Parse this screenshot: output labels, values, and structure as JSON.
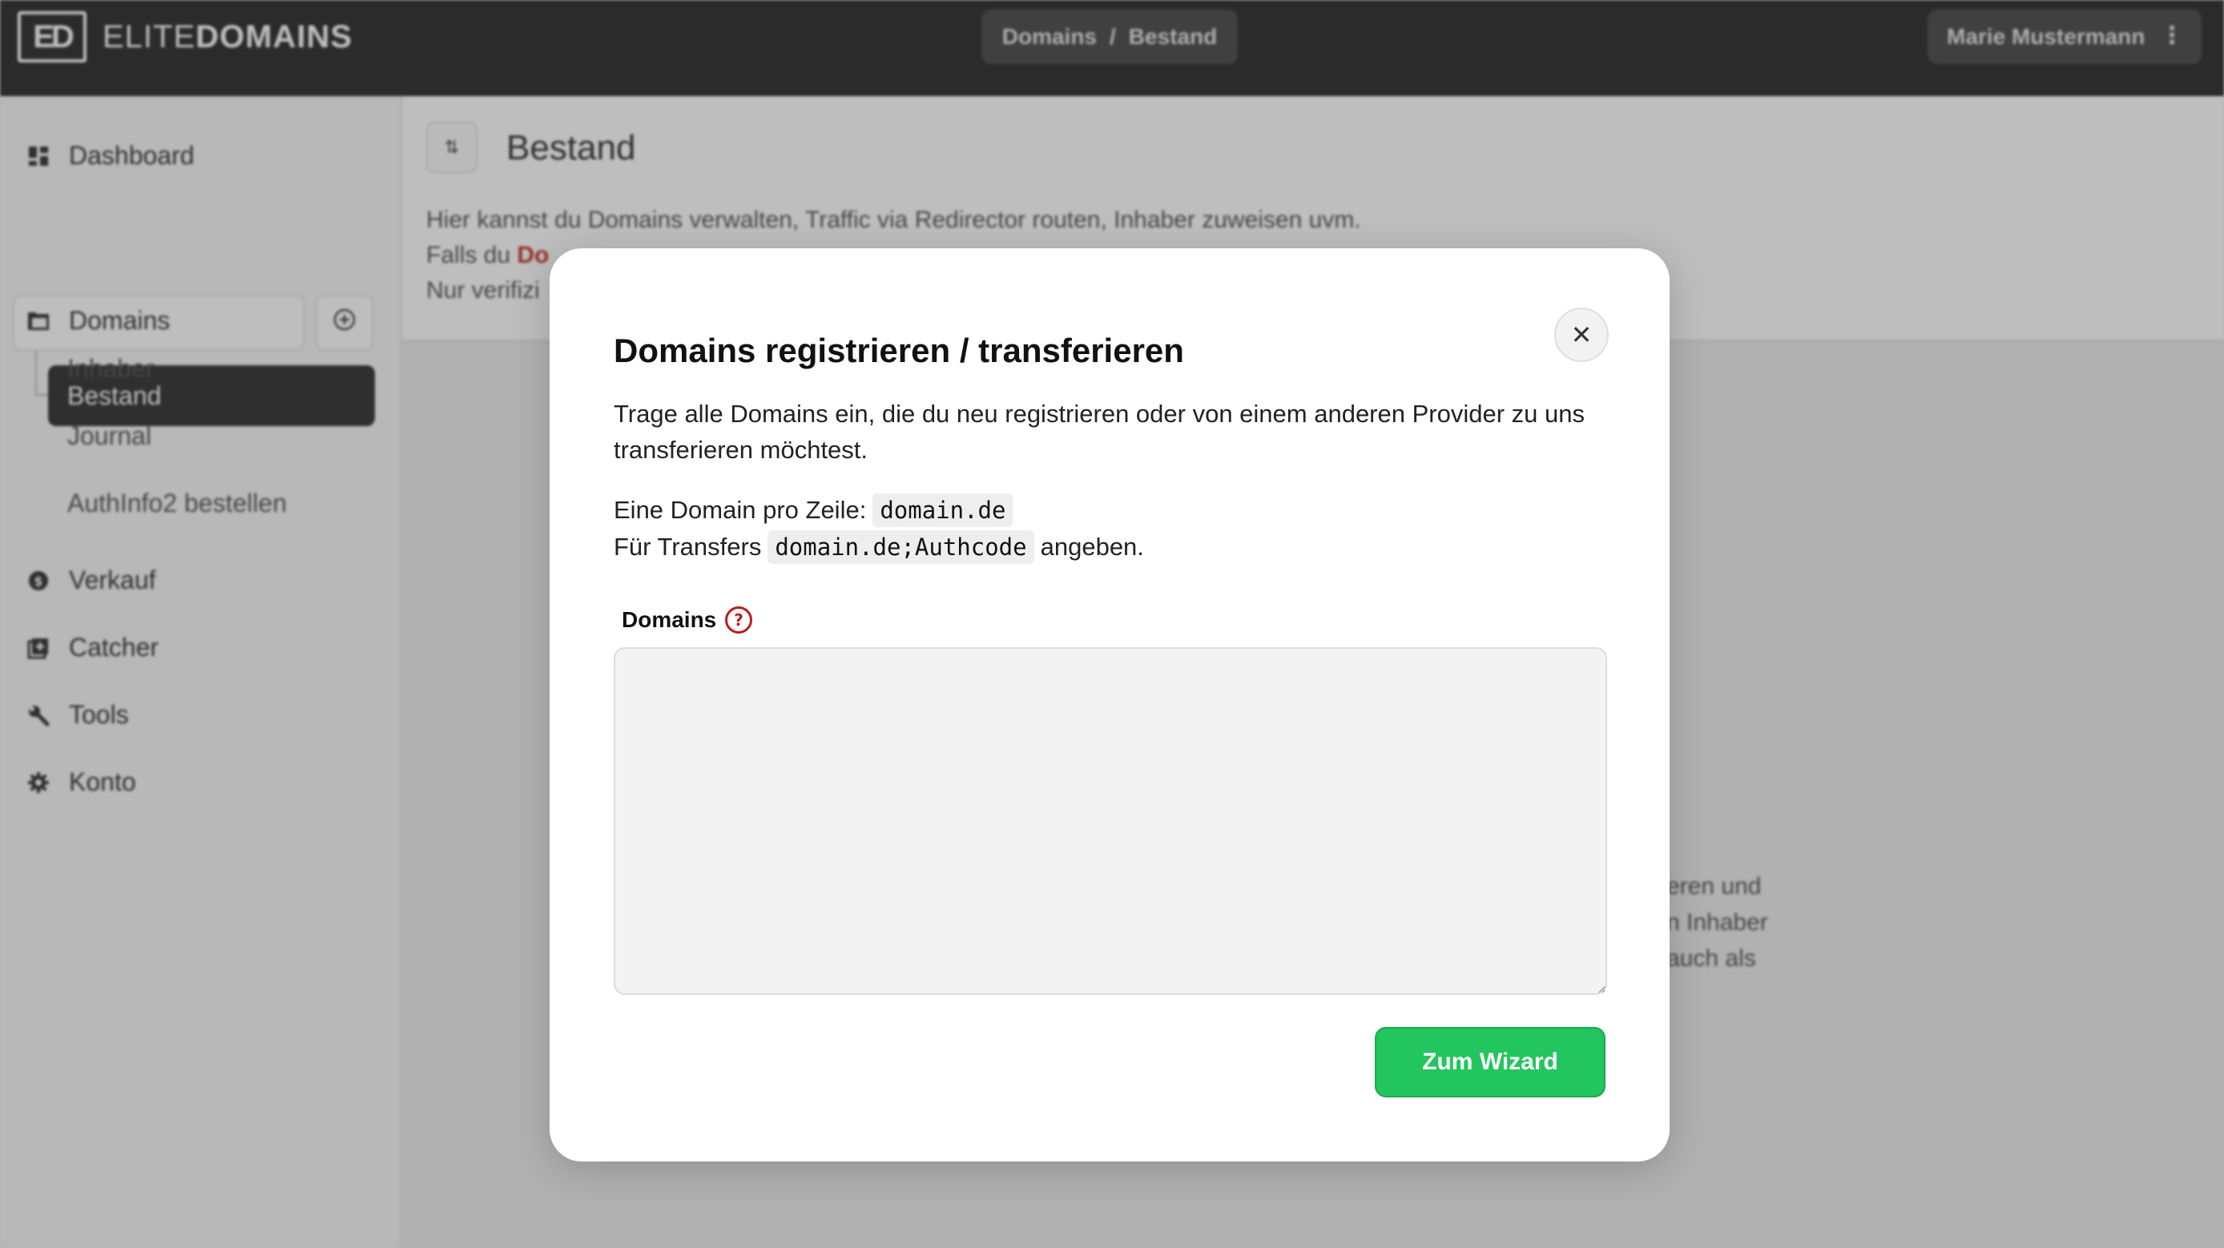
{
  "brand": {
    "mark": "ED",
    "name_light": "ELITE",
    "name_bold": "DOMAINS"
  },
  "header": {
    "breadcrumb": [
      "Domains",
      "/",
      "Bestand"
    ],
    "user_name": "Marie Mustermann"
  },
  "sidebar": {
    "items": [
      {
        "label": "Dashboard",
        "icon": "dashboard-icon"
      },
      {
        "label": "Domains",
        "icon": "folder-icon"
      },
      {
        "label": "Verkauf",
        "icon": "dollar-icon"
      },
      {
        "label": "Catcher",
        "icon": "catcher-icon"
      },
      {
        "label": "Tools",
        "icon": "wrench-icon"
      },
      {
        "label": "Konto",
        "icon": "gear-icon"
      }
    ],
    "sub_items": [
      "Bestand",
      "Inhaber",
      "Journal",
      "AuthInfo2 bestellen"
    ]
  },
  "page": {
    "title": "Bestand",
    "intro_line1": "Hier kannst du Domains verwalten, Traffic via Redirector routen, Inhaber zuweisen uvm.",
    "intro_line2_prefix": "Falls du",
    "intro_line2_red": "Do",
    "intro_line3_prefix": "Nur verifizi",
    "bg_fragments": [
      "eren und",
      "n Inhaber",
      "auch als"
    ]
  },
  "modal": {
    "title": "Domains registrieren / transferieren",
    "description": "Trage alle Domains ein, die du neu registrieren oder von einem anderen Provider zu uns transferieren möchtest.",
    "hint1_text": "Eine Domain pro Zeile:",
    "hint1_code": "domain.de",
    "hint2_text": "Für Transfers",
    "hint2_code": "domain.de;Authcode",
    "hint2_suffix": "angeben.",
    "field_label": "Domains",
    "textarea_value": "",
    "submit_label": "Zum Wizard",
    "close_symbol": "✕"
  },
  "colors": {
    "accent_green": "#22c55e",
    "help_red": "#b91c1c",
    "topbar": "#2d2d2d"
  }
}
